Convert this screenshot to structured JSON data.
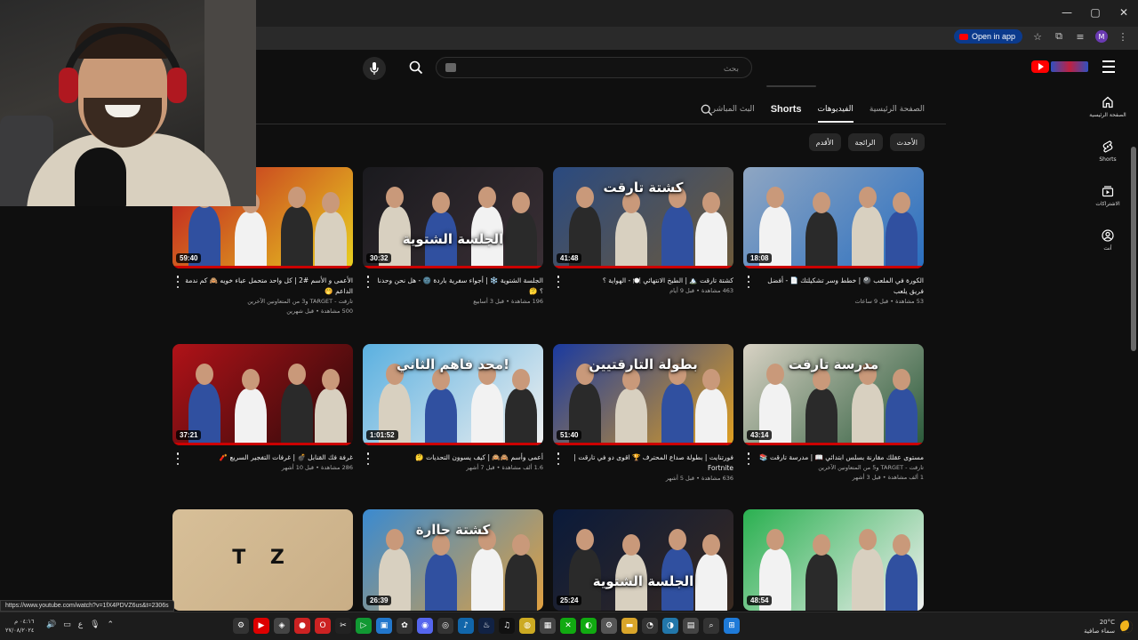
{
  "browser": {
    "open_app_label": "Open in app",
    "window_controls": [
      "—",
      "▢",
      "✕"
    ]
  },
  "header": {
    "search_placeholder": "بحث"
  },
  "guide": {
    "items": [
      {
        "label": "الصفحة الرئيسية",
        "icon": "home-icon"
      },
      {
        "label": "Shorts",
        "icon": "shorts-icon"
      },
      {
        "label": "الاشتراكات",
        "icon": "subscriptions-icon"
      },
      {
        "label": "أنت",
        "icon": "you-icon"
      }
    ]
  },
  "tabs": [
    {
      "label": "الصفحة الرئيسية",
      "active": false
    },
    {
      "label": "الفيديوهات",
      "active": true
    },
    {
      "label": "Shorts",
      "active": false
    },
    {
      "label": "البث المباشر",
      "active": false
    }
  ],
  "chips": [
    "الأحدث",
    "الرائجة",
    "الأقدم"
  ],
  "videos": [
    {
      "duration": "18:08",
      "title": "الكورة في الملعب 🎱 | خطط وسر تشكيلتك 📄 - أفضل فريق يلعب",
      "channel": "",
      "views": "53 مشاهدة • قبل 9 ساعات",
      "thumb_text": "",
      "colors": [
        "#8fa6c2",
        "#2a6fc0"
      ]
    },
    {
      "duration": "41:48",
      "title": "كشتة تارقت 🏔️ | الطبخ الانتهائي 🍽️ - الهواية ؟",
      "channel": "",
      "views": "463 مشاهدة • قبل 9 أيام",
      "thumb_text": "كشتة تارقت",
      "colors": [
        "#2a4a80",
        "#6d5a3b"
      ]
    },
    {
      "duration": "30:32",
      "title": "الجلسة الشتوية ❄️ | أجواء سفرية باردة 🌚 - هل نحن وحدنا ؟ 🤔",
      "channel": "",
      "views": "196 مشاهدة • قبل 3 أسابيع",
      "thumb_text": "الجلسة الشتوية",
      "colors": [
        "#1a1a1e",
        "#3a2f35"
      ]
    },
    {
      "duration": "59:40",
      "title": "الأعمى و الأسم #2 | كل واحد متحمل عباء خويه 🙈 كم ندمة الداعم 🤭",
      "channel": "تارقت - TARGET و3 من المتعاونين الآخرين",
      "views": "500 مشاهدة • قبل شهرين",
      "thumb_text": "",
      "colors": [
        "#c01820",
        "#e8d020"
      ]
    },
    {
      "duration": "43:14",
      "title": "مستوى عقلك مقارنة بسلس ابتدائي 📖 | مدرسة تارقت 📚",
      "channel": "تارقت - TARGET و5 من المتعاونين الآخرين",
      "views": "1 ألف مشاهدة • قبل 3 أشهر",
      "thumb_text": "مدرسة تارقت",
      "colors": [
        "#d8d2c4",
        "#2a5a3a"
      ]
    },
    {
      "duration": "51:40",
      "title": "فورتنايت | بطولة صداع المحترف 🏆 اقوى دو في تارقت | Fortnite",
      "channel": "",
      "views": "636 مشاهدة • قبل 5 أشهر",
      "thumb_text": "بطولة التارقتيين",
      "colors": [
        "#1a3aa0",
        "#e0a020"
      ]
    },
    {
      "duration": "1:01:52",
      "title": "أعمى وأسم 🙈🙉 | كيف يسوون التحديات 🤔",
      "channel": "",
      "views": "1.6 ألف مشاهدة • قبل 7 أشهر",
      "thumb_text": "محد فاهم الثاني!",
      "colors": [
        "#5ab0e0",
        "#f0f0f0"
      ]
    },
    {
      "duration": "37:21",
      "title": "غرفة فك القنابل 💣 | غرفات التفجير السريع 🧨",
      "channel": "",
      "views": "286 مشاهدة • قبل 10 أشهر",
      "thumb_text": "",
      "colors": [
        "#b01218",
        "#2a0a0a"
      ]
    },
    {
      "duration": "48:54",
      "title": "",
      "channel": "",
      "views": "",
      "thumb_text": "",
      "colors": [
        "#2ab050",
        "#f0f0f0"
      ]
    },
    {
      "duration": "25:24",
      "title": "",
      "channel": "",
      "views": "",
      "thumb_text": "الجلسة الشتوية",
      "colors": [
        "#0a1a3a",
        "#3a2a20"
      ]
    },
    {
      "duration": "26:39",
      "title": "",
      "channel": "",
      "views": "",
      "thumb_text": "كشتة حاارة",
      "colors": [
        "#3a8ad0",
        "#e0a040"
      ]
    },
    {
      "duration": "",
      "title": "",
      "channel": "",
      "views": "",
      "thumb_text": "T Z",
      "colors": [
        "#d7bf98",
        "#c9ae86"
      ]
    }
  ],
  "status_url": "https://www.youtube.com/watch?v=1fX4PDVZ6us&t=2306s",
  "taskbar": {
    "time": "٠٤:١٦ م",
    "date": "٢٧/٠٨/٢٠٢٤",
    "lang": "ع",
    "temp": "20°C",
    "weather": "سماء صافية"
  }
}
